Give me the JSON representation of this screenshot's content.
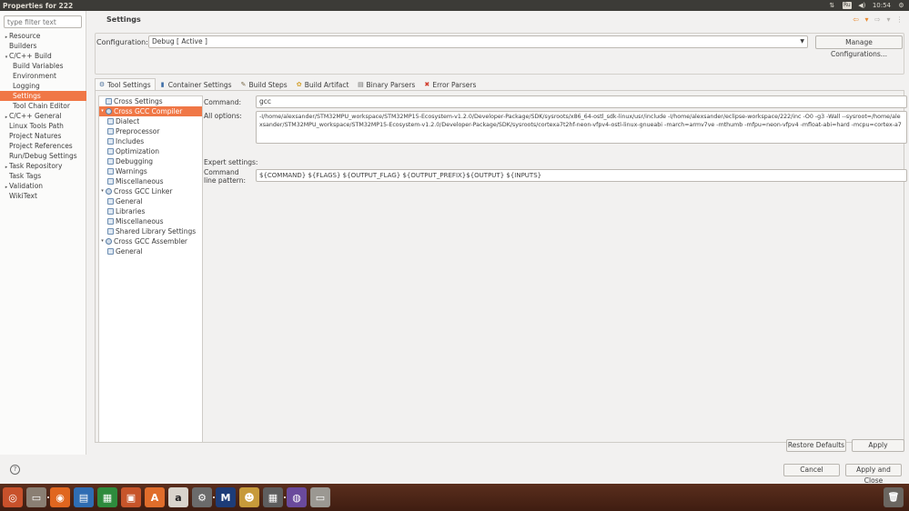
{
  "window": {
    "title": "Properties for 222"
  },
  "tray": {
    "keyboard": "Ru",
    "clock": "10:54"
  },
  "filter": {
    "placeholder": "type filter text"
  },
  "nav": [
    {
      "label": "Resource",
      "indent": 0,
      "twisty": "▸"
    },
    {
      "label": "Builders",
      "indent": 0,
      "twisty": ""
    },
    {
      "label": "C/C++ Build",
      "indent": 0,
      "twisty": "▾"
    },
    {
      "label": "Build Variables",
      "indent": 1,
      "twisty": ""
    },
    {
      "label": "Environment",
      "indent": 1,
      "twisty": ""
    },
    {
      "label": "Logging",
      "indent": 1,
      "twisty": ""
    },
    {
      "label": "Settings",
      "indent": 1,
      "twisty": "",
      "selected": true
    },
    {
      "label": "Tool Chain Editor",
      "indent": 1,
      "twisty": ""
    },
    {
      "label": "C/C++ General",
      "indent": 0,
      "twisty": "▸"
    },
    {
      "label": "Linux Tools Path",
      "indent": 0,
      "twisty": ""
    },
    {
      "label": "Project Natures",
      "indent": 0,
      "twisty": ""
    },
    {
      "label": "Project References",
      "indent": 0,
      "twisty": ""
    },
    {
      "label": "Run/Debug Settings",
      "indent": 0,
      "twisty": ""
    },
    {
      "label": "Task Repository",
      "indent": 0,
      "twisty": "▸"
    },
    {
      "label": "Task Tags",
      "indent": 0,
      "twisty": ""
    },
    {
      "label": "Validation",
      "indent": 0,
      "twisty": "▸"
    },
    {
      "label": "WikiText",
      "indent": 0,
      "twisty": ""
    }
  ],
  "page": {
    "title": "Settings"
  },
  "configuration": {
    "label": "Configuration:",
    "value": "Debug  [ Active ]",
    "manage_label": "Manage Configurations..."
  },
  "tabs": [
    {
      "label": "Tool Settings",
      "icon": "tool-settings-icon",
      "glyph": "⚙",
      "color": "#4a6f9a",
      "active": true
    },
    {
      "label": "Container Settings",
      "icon": "container-icon",
      "glyph": "▮",
      "color": "#3f6ea8"
    },
    {
      "label": "Build Steps",
      "icon": "build-steps-icon",
      "glyph": "✎",
      "color": "#7a6a4a"
    },
    {
      "label": "Build Artifact",
      "icon": "build-artifact-icon",
      "glyph": "✿",
      "color": "#d4a12e"
    },
    {
      "label": "Binary Parsers",
      "icon": "binary-parsers-icon",
      "glyph": "▤",
      "color": "#6a6a6a"
    },
    {
      "label": "Error Parsers",
      "icon": "error-parsers-icon",
      "glyph": "✖",
      "color": "#d03a2a"
    }
  ],
  "tooltree": [
    {
      "label": "Cross Settings",
      "level": 0,
      "twisty": "",
      "gear": false
    },
    {
      "label": "Cross GCC Compiler",
      "level": 0,
      "twisty": "▾",
      "gear": true,
      "selected": true
    },
    {
      "label": "Dialect",
      "level": 1,
      "twisty": ""
    },
    {
      "label": "Preprocessor",
      "level": 1,
      "twisty": ""
    },
    {
      "label": "Includes",
      "level": 1,
      "twisty": ""
    },
    {
      "label": "Optimization",
      "level": 1,
      "twisty": ""
    },
    {
      "label": "Debugging",
      "level": 1,
      "twisty": ""
    },
    {
      "label": "Warnings",
      "level": 1,
      "twisty": ""
    },
    {
      "label": "Miscellaneous",
      "level": 1,
      "twisty": ""
    },
    {
      "label": "Cross GCC Linker",
      "level": 0,
      "twisty": "▾",
      "gear": true
    },
    {
      "label": "General",
      "level": 1,
      "twisty": ""
    },
    {
      "label": "Libraries",
      "level": 1,
      "twisty": ""
    },
    {
      "label": "Miscellaneous",
      "level": 1,
      "twisty": ""
    },
    {
      "label": "Shared Library Settings",
      "level": 1,
      "twisty": ""
    },
    {
      "label": "Cross GCC Assembler",
      "level": 0,
      "twisty": "▾",
      "gear": true
    },
    {
      "label": "General",
      "level": 1,
      "twisty": ""
    }
  ],
  "options": {
    "command_label": "Command:",
    "command_value": "gcc",
    "all_options_label": "All options:",
    "all_options_value": "-I/home/alexsander/STM32MPU_workspace/STM32MP15-Ecosystem-v1.2.0/Developer-Package/SDK/sysroots/x86_64-ostl_sdk-linux/usr/include -I/home/alexsander/eclipse-workspace/222/inc -O0 -g3 -Wall --sysroot=/home/alexsander/STM32MPU_workspace/STM32MP15-Ecosystem-v1.2.0/Developer-Package/SDK/sysroots/cortexa7t2hf-neon-vfpv4-ostl-linux-gnueabi -march=armv7ve -mthumb -mfpu=neon-vfpv4 -mfloat-abi=hard -mcpu=cortex-a7",
    "expert_label": "Expert settings:",
    "pattern_label_1": "Command",
    "pattern_label_2": "line pattern:",
    "pattern_value": "${COMMAND} ${FLAGS} ${OUTPUT_FLAG} ${OUTPUT_PREFIX}${OUTPUT} ${INPUTS}"
  },
  "buttons": {
    "restore": "Restore Defaults",
    "apply": "Apply",
    "cancel": "Cancel",
    "apply_close": "Apply and Close"
  },
  "help": {
    "glyph": "?"
  },
  "launcher": [
    {
      "name": "ubuntu-dash-icon",
      "glyph": "◎",
      "bg": "#c8512b"
    },
    {
      "name": "files-icon",
      "glyph": "▭",
      "bg": "#8a7f73"
    },
    {
      "name": "firefox-icon",
      "glyph": "◉",
      "bg": "#e0661f",
      "running": true
    },
    {
      "name": "writer-icon",
      "glyph": "▤",
      "bg": "#2f6db3"
    },
    {
      "name": "calc-icon",
      "glyph": "▦",
      "bg": "#2e8b3d"
    },
    {
      "name": "impress-icon",
      "glyph": "▣",
      "bg": "#c7552a"
    },
    {
      "name": "software-center-icon",
      "glyph": "A",
      "bg": "#e06d2b"
    },
    {
      "name": "amazon-icon",
      "glyph": "a",
      "bg": "#d9d4cc"
    },
    {
      "name": "settings-icon",
      "glyph": "⚙",
      "bg": "#6b6b6b"
    },
    {
      "name": "stm32cubemx-icon",
      "glyph": "M",
      "bg": "#1d3c78",
      "running": true
    },
    {
      "name": "gimp-icon",
      "glyph": "☻",
      "bg": "#c79a3a"
    },
    {
      "name": "calculator-icon",
      "glyph": "▦",
      "bg": "#5e5e5e"
    },
    {
      "name": "eclipse-icon",
      "glyph": "◍",
      "bg": "#6a4a9c",
      "running": true
    },
    {
      "name": "drive-icon",
      "glyph": "▭",
      "bg": "#9b9892"
    }
  ]
}
